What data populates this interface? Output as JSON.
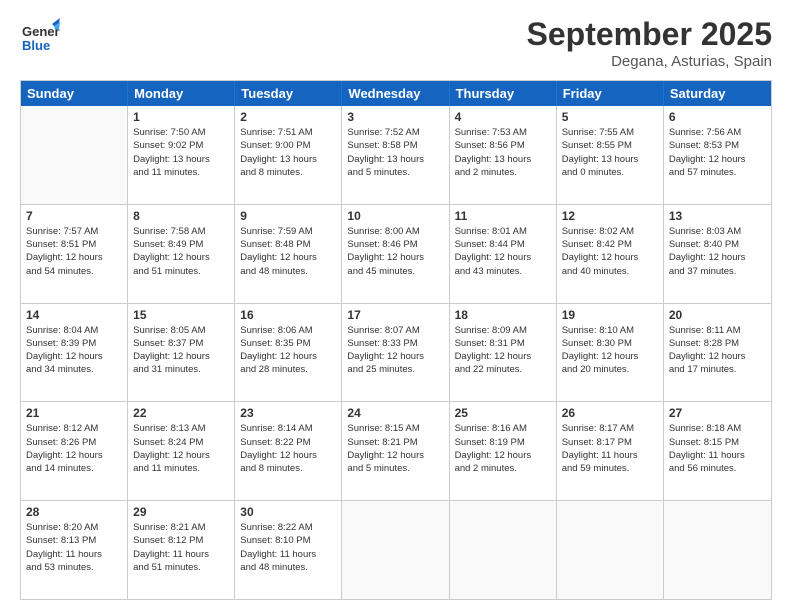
{
  "header": {
    "logo_line1": "General",
    "logo_line2": "Blue",
    "month": "September 2025",
    "location": "Degana, Asturias, Spain"
  },
  "days_of_week": [
    "Sunday",
    "Monday",
    "Tuesday",
    "Wednesday",
    "Thursday",
    "Friday",
    "Saturday"
  ],
  "weeks": [
    [
      {
        "day": "",
        "content": ""
      },
      {
        "day": "1",
        "content": "Sunrise: 7:50 AM\nSunset: 9:02 PM\nDaylight: 13 hours\nand 11 minutes."
      },
      {
        "day": "2",
        "content": "Sunrise: 7:51 AM\nSunset: 9:00 PM\nDaylight: 13 hours\nand 8 minutes."
      },
      {
        "day": "3",
        "content": "Sunrise: 7:52 AM\nSunset: 8:58 PM\nDaylight: 13 hours\nand 5 minutes."
      },
      {
        "day": "4",
        "content": "Sunrise: 7:53 AM\nSunset: 8:56 PM\nDaylight: 13 hours\nand 2 minutes."
      },
      {
        "day": "5",
        "content": "Sunrise: 7:55 AM\nSunset: 8:55 PM\nDaylight: 13 hours\nand 0 minutes."
      },
      {
        "day": "6",
        "content": "Sunrise: 7:56 AM\nSunset: 8:53 PM\nDaylight: 12 hours\nand 57 minutes."
      }
    ],
    [
      {
        "day": "7",
        "content": "Sunrise: 7:57 AM\nSunset: 8:51 PM\nDaylight: 12 hours\nand 54 minutes."
      },
      {
        "day": "8",
        "content": "Sunrise: 7:58 AM\nSunset: 8:49 PM\nDaylight: 12 hours\nand 51 minutes."
      },
      {
        "day": "9",
        "content": "Sunrise: 7:59 AM\nSunset: 8:48 PM\nDaylight: 12 hours\nand 48 minutes."
      },
      {
        "day": "10",
        "content": "Sunrise: 8:00 AM\nSunset: 8:46 PM\nDaylight: 12 hours\nand 45 minutes."
      },
      {
        "day": "11",
        "content": "Sunrise: 8:01 AM\nSunset: 8:44 PM\nDaylight: 12 hours\nand 43 minutes."
      },
      {
        "day": "12",
        "content": "Sunrise: 8:02 AM\nSunset: 8:42 PM\nDaylight: 12 hours\nand 40 minutes."
      },
      {
        "day": "13",
        "content": "Sunrise: 8:03 AM\nSunset: 8:40 PM\nDaylight: 12 hours\nand 37 minutes."
      }
    ],
    [
      {
        "day": "14",
        "content": "Sunrise: 8:04 AM\nSunset: 8:39 PM\nDaylight: 12 hours\nand 34 minutes."
      },
      {
        "day": "15",
        "content": "Sunrise: 8:05 AM\nSunset: 8:37 PM\nDaylight: 12 hours\nand 31 minutes."
      },
      {
        "day": "16",
        "content": "Sunrise: 8:06 AM\nSunset: 8:35 PM\nDaylight: 12 hours\nand 28 minutes."
      },
      {
        "day": "17",
        "content": "Sunrise: 8:07 AM\nSunset: 8:33 PM\nDaylight: 12 hours\nand 25 minutes."
      },
      {
        "day": "18",
        "content": "Sunrise: 8:09 AM\nSunset: 8:31 PM\nDaylight: 12 hours\nand 22 minutes."
      },
      {
        "day": "19",
        "content": "Sunrise: 8:10 AM\nSunset: 8:30 PM\nDaylight: 12 hours\nand 20 minutes."
      },
      {
        "day": "20",
        "content": "Sunrise: 8:11 AM\nSunset: 8:28 PM\nDaylight: 12 hours\nand 17 minutes."
      }
    ],
    [
      {
        "day": "21",
        "content": "Sunrise: 8:12 AM\nSunset: 8:26 PM\nDaylight: 12 hours\nand 14 minutes."
      },
      {
        "day": "22",
        "content": "Sunrise: 8:13 AM\nSunset: 8:24 PM\nDaylight: 12 hours\nand 11 minutes."
      },
      {
        "day": "23",
        "content": "Sunrise: 8:14 AM\nSunset: 8:22 PM\nDaylight: 12 hours\nand 8 minutes."
      },
      {
        "day": "24",
        "content": "Sunrise: 8:15 AM\nSunset: 8:21 PM\nDaylight: 12 hours\nand 5 minutes."
      },
      {
        "day": "25",
        "content": "Sunrise: 8:16 AM\nSunset: 8:19 PM\nDaylight: 12 hours\nand 2 minutes."
      },
      {
        "day": "26",
        "content": "Sunrise: 8:17 AM\nSunset: 8:17 PM\nDaylight: 11 hours\nand 59 minutes."
      },
      {
        "day": "27",
        "content": "Sunrise: 8:18 AM\nSunset: 8:15 PM\nDaylight: 11 hours\nand 56 minutes."
      }
    ],
    [
      {
        "day": "28",
        "content": "Sunrise: 8:20 AM\nSunset: 8:13 PM\nDaylight: 11 hours\nand 53 minutes."
      },
      {
        "day": "29",
        "content": "Sunrise: 8:21 AM\nSunset: 8:12 PM\nDaylight: 11 hours\nand 51 minutes."
      },
      {
        "day": "30",
        "content": "Sunrise: 8:22 AM\nSunset: 8:10 PM\nDaylight: 11 hours\nand 48 minutes."
      },
      {
        "day": "",
        "content": ""
      },
      {
        "day": "",
        "content": ""
      },
      {
        "day": "",
        "content": ""
      },
      {
        "day": "",
        "content": ""
      }
    ]
  ]
}
